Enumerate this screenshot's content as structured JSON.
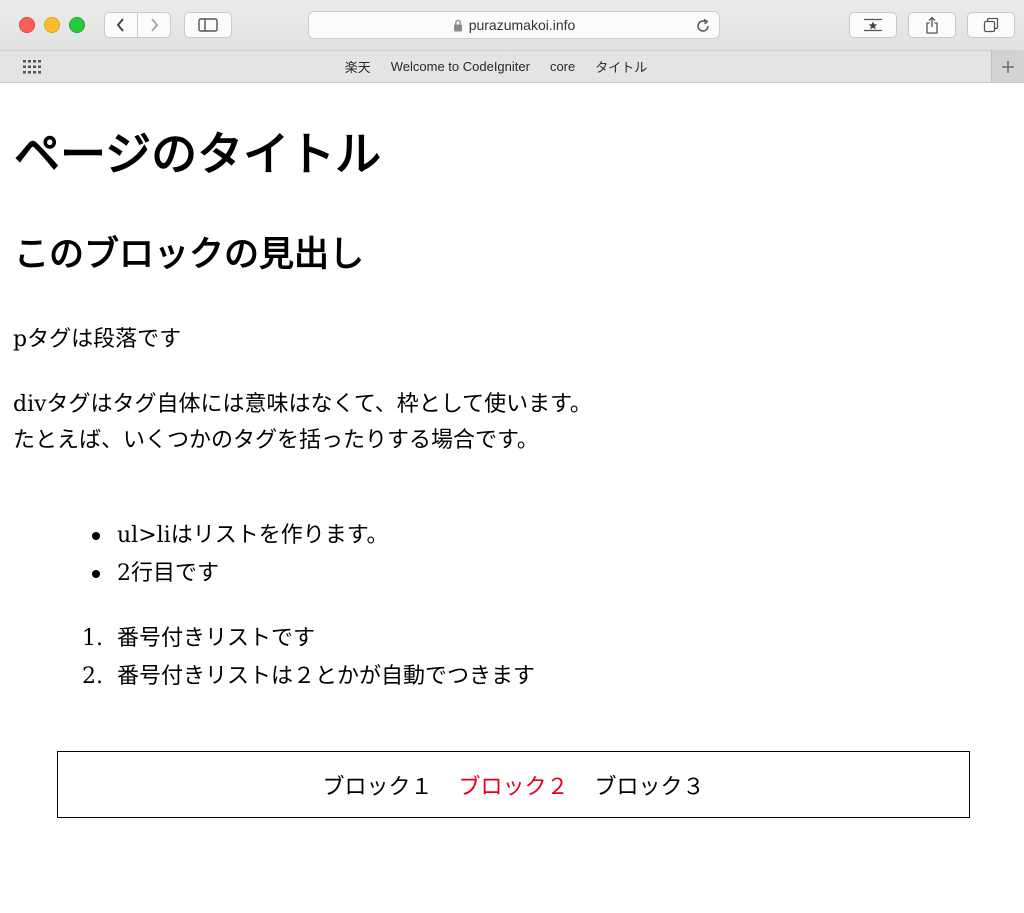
{
  "browser": {
    "address_text": "purazumakoi.info",
    "bookmarks": [
      "楽天",
      "Welcome to CodeIgniter",
      "core",
      "タイトル"
    ]
  },
  "page": {
    "title": "ページのタイトル",
    "block_heading": "このブロックの見出し",
    "p_text": "pタグは段落です",
    "div_text_line1": "divタグはタグ自体には意味はなくて、枠として使います。",
    "div_text_line2": "たとえば、いくつかのタグを括ったりする場合です。",
    "bullet_items": [
      "ul>liはリストを作ります。",
      "2行目です"
    ],
    "ordered_items": [
      {
        "number": "1.",
        "text": "番号付きリストです"
      },
      {
        "number": "2.",
        "text": "番号付きリストは２とかが自動でつきます"
      }
    ],
    "blocks": [
      "ブロック１",
      "ブロック２",
      "ブロック３"
    ]
  },
  "colors": {
    "highlight": "#e4001b"
  },
  "icons": [
    "back-icon",
    "forward-icon",
    "sidebar-icon",
    "lock-icon",
    "reload-icon",
    "bookmark-star-icon",
    "share-icon",
    "tabs-icon",
    "favorites-grid-icon",
    "plus-icon"
  ]
}
